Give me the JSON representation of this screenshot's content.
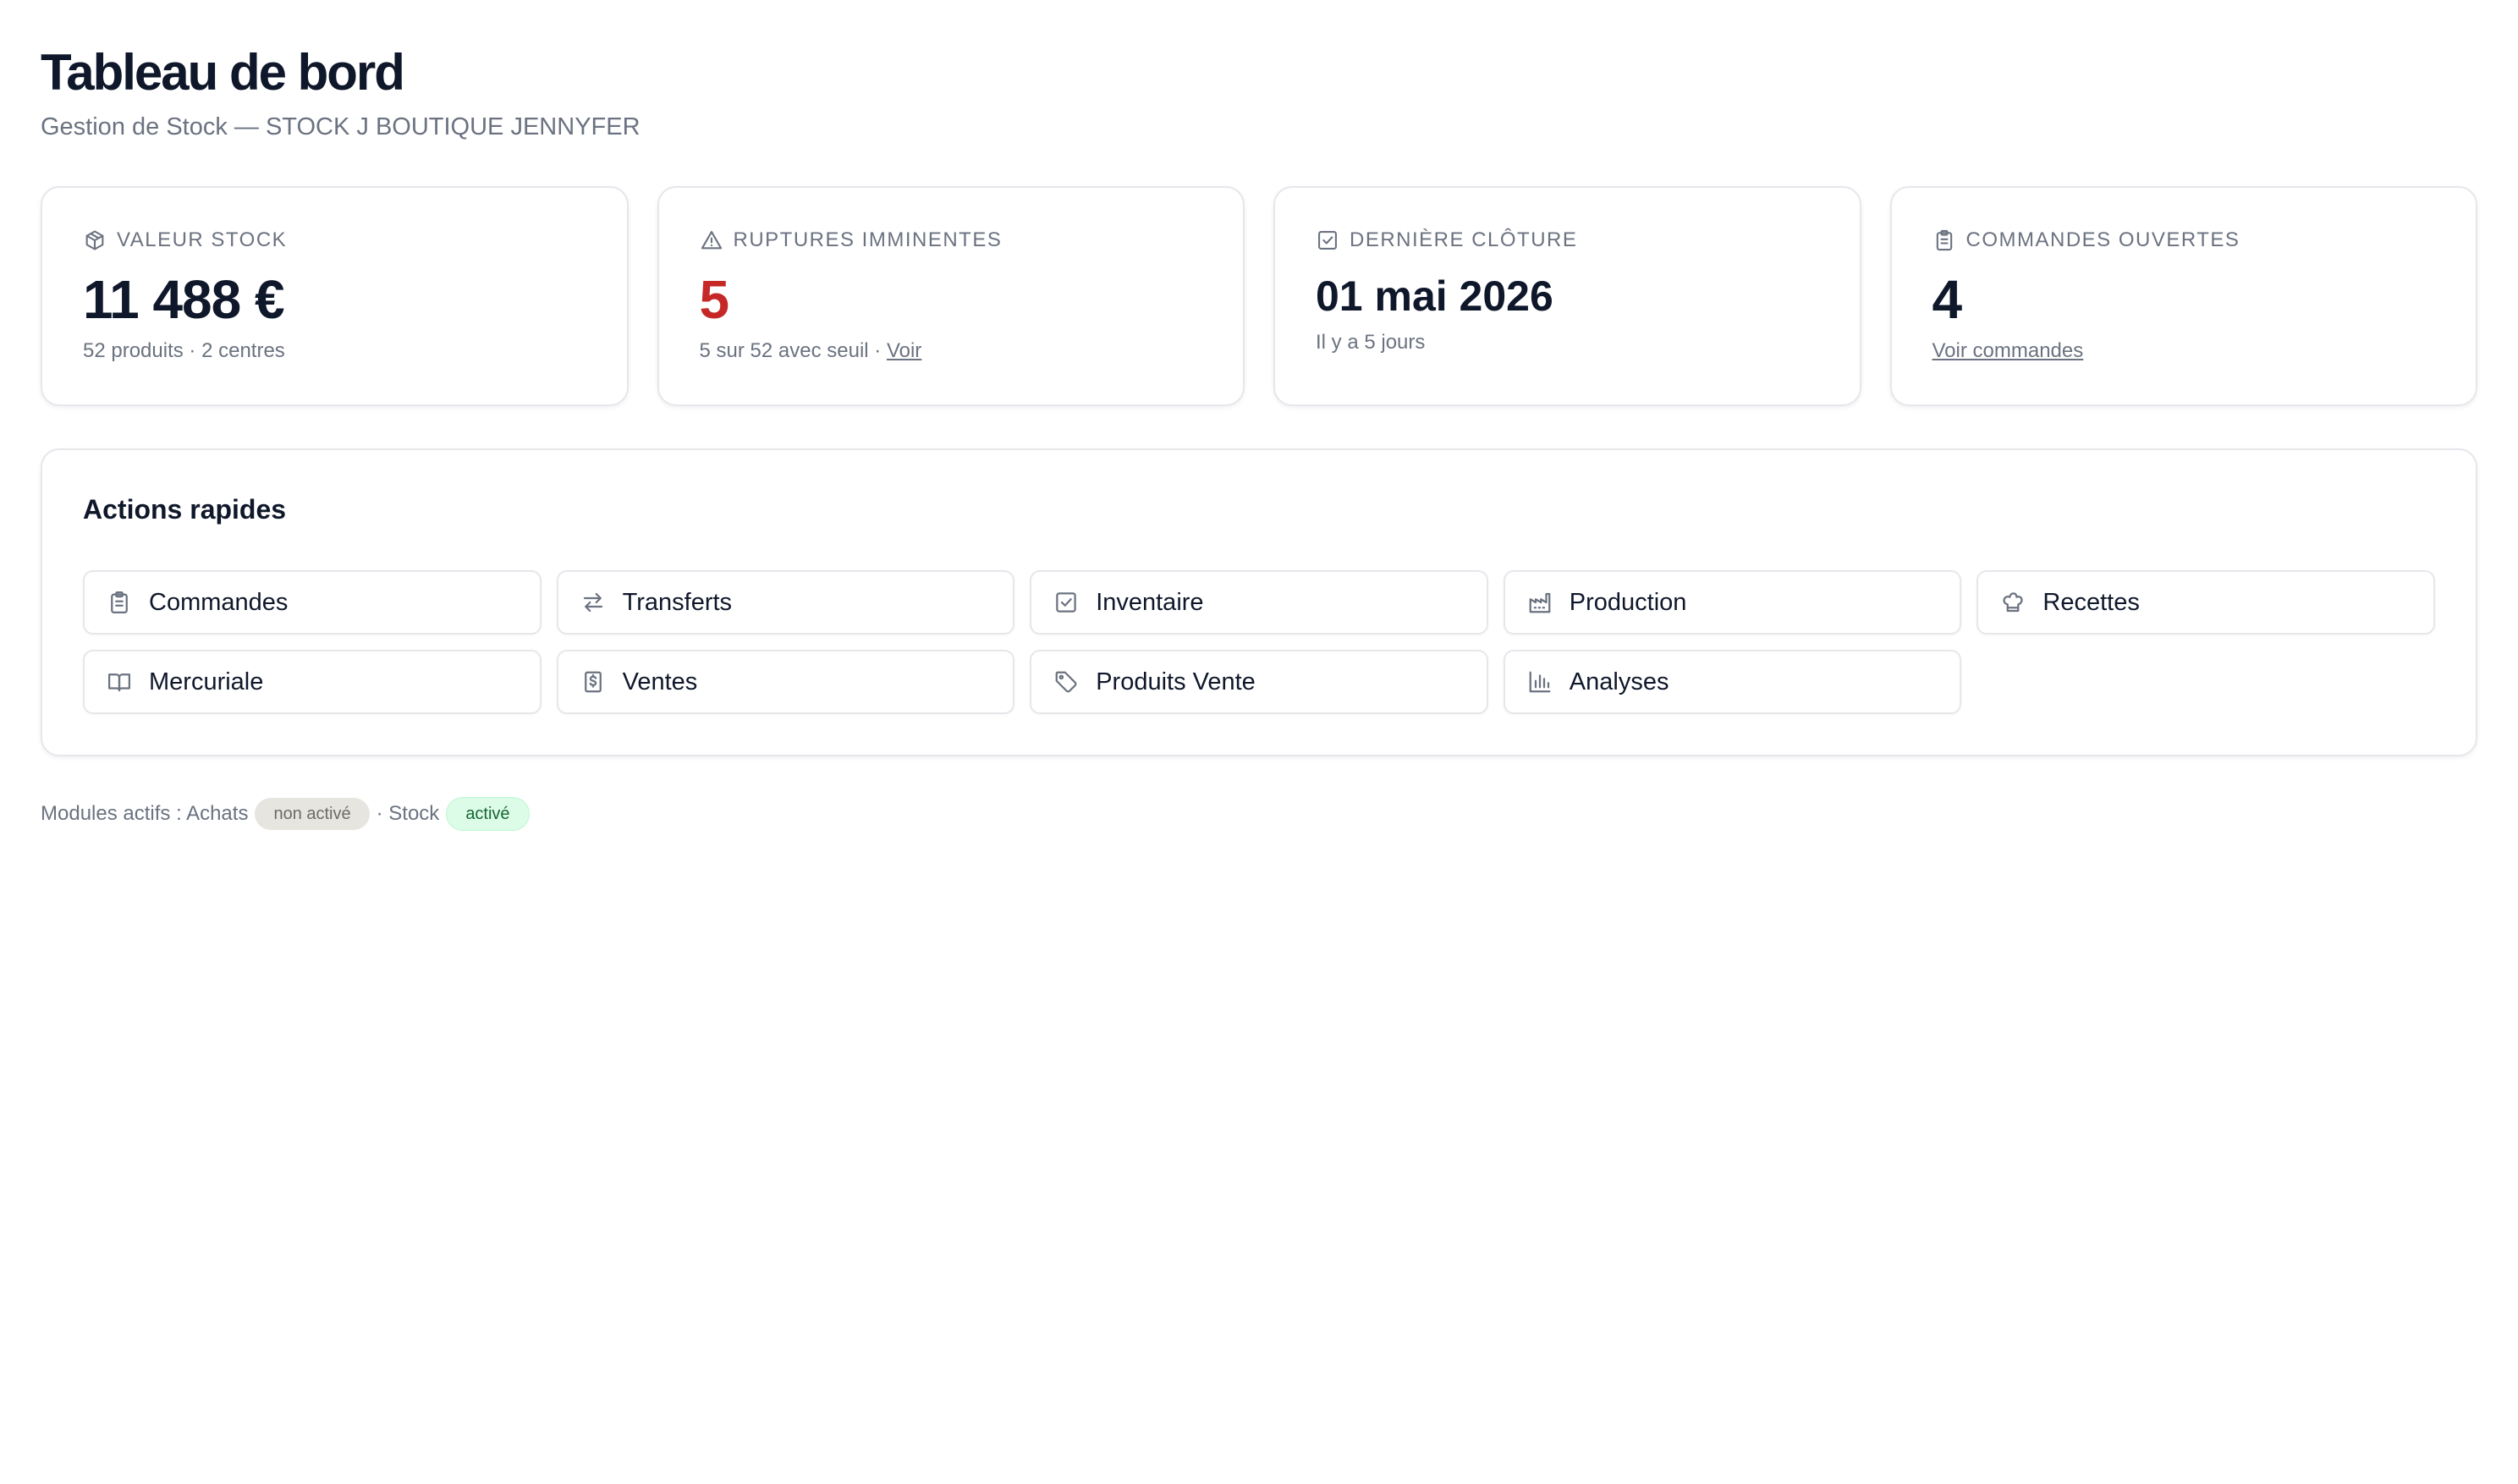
{
  "header": {
    "title": "Tableau de bord",
    "subtitle": "Gestion de Stock — STOCK J BOUTIQUE JENNYFER"
  },
  "kpis": [
    {
      "icon": "box-icon",
      "label": "VALEUR STOCK",
      "value": "11 488 €",
      "sub": "52 produits · 2 centres"
    },
    {
      "icon": "alert-triangle-icon",
      "label": "RUPTURES IMMINENTES",
      "value": "5",
      "value_color": "#c62828",
      "sub": "5 sur 52 avec seuil · ",
      "link": "Voir"
    },
    {
      "icon": "check-square-icon",
      "label": "DERNIÈRE CLÔTURE",
      "value": "01 mai 2026",
      "sub": "Il y a 5 jours"
    },
    {
      "icon": "clipboard-icon",
      "label": "COMMANDES OUVERTES",
      "value": "4",
      "link": "Voir commandes"
    }
  ],
  "actions": {
    "title": "Actions rapides",
    "items": [
      {
        "label": "Commandes",
        "icon": "clipboard-icon"
      },
      {
        "label": "Transferts",
        "icon": "arrows-left-right-icon"
      },
      {
        "label": "Inventaire",
        "icon": "check-square-icon"
      },
      {
        "label": "Production",
        "icon": "factory-icon"
      },
      {
        "label": "Recettes",
        "icon": "chef-hat-icon"
      },
      {
        "label": "Mercuriale",
        "icon": "book-open-icon"
      },
      {
        "label": "Ventes",
        "icon": "receipt-icon"
      },
      {
        "label": "Produits Vente",
        "icon": "tag-icon"
      },
      {
        "label": "Analyses",
        "icon": "bar-chart-icon"
      }
    ]
  },
  "modules": {
    "prefix": "Modules actifs : Achats",
    "achats_status": "non activé",
    "separator": "· Stock",
    "stock_status": "activé"
  },
  "colors": {
    "text": "#0f172a",
    "muted": "#6b7280",
    "danger": "#c62828",
    "border": "#e5e7eb",
    "badge_off_bg": "#e7e5df",
    "badge_on_bg": "#dcfce7",
    "badge_on_text": "#166534"
  }
}
